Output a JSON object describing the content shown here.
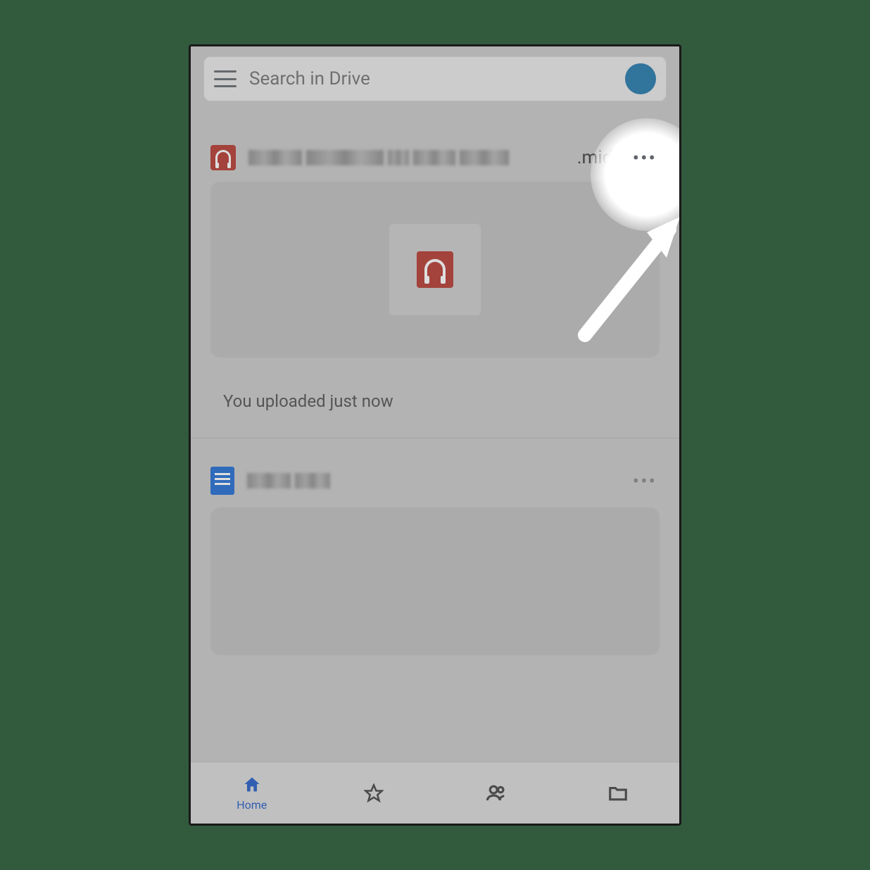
{
  "search": {
    "placeholder": "Search in Drive"
  },
  "files": [
    {
      "type": "midi",
      "name_redacted": true,
      "extension": ".midi",
      "status": "You uploaded just now"
    },
    {
      "type": "doc",
      "name_redacted": true
    }
  ],
  "nav": {
    "home": "Home",
    "starred": "Starred",
    "shared": "Shared",
    "files": "Files"
  },
  "colors": {
    "accent_blue": "#1a56c4",
    "avatar_blue": "#1a73a8",
    "midi_red": "#b33128",
    "doc_blue": "#1967d2"
  },
  "icons": {
    "hamburger": "menu-icon",
    "avatar": "profile-avatar",
    "more": "more-icon",
    "midi": "headphones-icon",
    "doc": "document-icon",
    "home": "home-icon",
    "star": "star-icon",
    "people": "people-icon",
    "folder": "folder-icon"
  }
}
